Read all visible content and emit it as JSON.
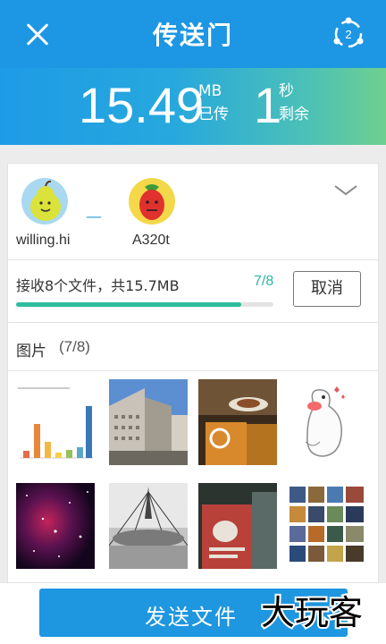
{
  "header": {
    "title": "传送门",
    "share_badge": "2",
    "sent_value": "15.49",
    "sent_unit_top": "MB",
    "sent_unit_bottom": "已传",
    "remaining_value": "1",
    "remaining_unit_top": "秒",
    "remaining_unit_bottom": "剩余"
  },
  "transfer": {
    "sender": "willing.hi",
    "receiver": "A320t",
    "info": "接收8个文件，共15.7MB",
    "count": "7/8",
    "progress": 0.875,
    "cancel_label": "取消"
  },
  "images_section": {
    "label": "图片",
    "count": "(7/8)",
    "thumbnails": [
      "chart-screenshot",
      "building-photo",
      "coffee-cup-photo",
      "cartoon-sticker",
      "night-sky-photo",
      "stupa-bw-photo",
      "book-cover-photo",
      "photo-grid-collage"
    ]
  },
  "footer": {
    "send_label": "发送文件",
    "watermark": "大玩客"
  },
  "colors": {
    "header_blue": "#1d96e3",
    "accent_green": "#2dbd9f",
    "button_blue": "#1e96e0"
  }
}
